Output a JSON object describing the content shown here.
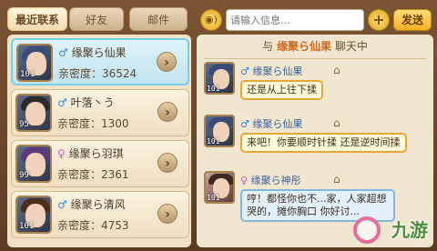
{
  "tabs": [
    {
      "label": "最近联系",
      "active": true
    },
    {
      "label": "好友",
      "active": false
    },
    {
      "label": "邮件",
      "active": false
    }
  ],
  "input": {
    "placeholder": "请输入信息..."
  },
  "buttons": {
    "voice_icon": "speaker-icon",
    "plus": "+",
    "send": "发送"
  },
  "contacts": [
    {
      "name": "缘聚ら仙果",
      "gender": "♂",
      "intimacy_label": "亲密度：",
      "intimacy": "36524",
      "level": "101",
      "hair_color": "#3a4c7a"
    },
    {
      "name": "叶落丶う",
      "gender": "♂",
      "intimacy_label": "亲密度：",
      "intimacy": "1300",
      "level": "95",
      "hair_color": "#2a2a2a"
    },
    {
      "name": "缘聚ら羽琪",
      "gender": "♀",
      "intimacy_label": "亲密度：",
      "intimacy": "2361",
      "level": "99",
      "hair_color": "#5a3a7a"
    },
    {
      "name": "缘聚ら清风",
      "gender": "♂",
      "intimacy_label": "亲密度：",
      "intimacy": "4753",
      "level": "101",
      "hair_color": "#4a2e1a"
    }
  ],
  "chat": {
    "header_prefix": "与",
    "with_name": "缘聚ら仙果",
    "header_suffix": "聊天中",
    "messages": [
      {
        "gender": "♂",
        "name": "缘聚ら仙果",
        "level": "101",
        "text": "还是从上往下揉"
      },
      {
        "gender": "♂",
        "name": "缘聚ら仙果",
        "level": "101",
        "text": "来吧！你要顺时针揉 还是逆时间揉"
      },
      {
        "gender": "♀",
        "name": "缘聚ら神彤",
        "level": "101",
        "text": "哼！都怪你也不...家，人家超想哭的，摊你胸口 你好讨..."
      }
    ]
  },
  "watermark": "九游"
}
